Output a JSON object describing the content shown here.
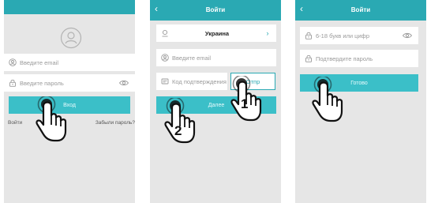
{
  "screen1": {
    "email_placeholder": "Введите email",
    "password_placeholder": "Введите пароль",
    "login_button": "Вход",
    "signin_link": "Войти",
    "forgot_link": "Забыли пароль?"
  },
  "screen2": {
    "title": "Войти",
    "country": "Украина",
    "email_placeholder": "Введите email",
    "code_placeholder": "Код подтверждения",
    "send_button": "Отпр",
    "next_button": "Далее",
    "step1": "1",
    "step2": "2"
  },
  "screen3": {
    "title": "Войти",
    "password_placeholder": "6-18 букв или цифр",
    "confirm_placeholder": "Подтвердите пароль",
    "done_button": "Готово"
  },
  "colors": {
    "accent": "#2aa9b3",
    "button": "#3bbfc8",
    "background": "#e6e6e6"
  },
  "icons": [
    "user-avatar-icon",
    "user-icon",
    "lock-icon",
    "eye-icon",
    "card-icon",
    "chevron-right-icon",
    "back-icon",
    "tap-hand-icon"
  ]
}
